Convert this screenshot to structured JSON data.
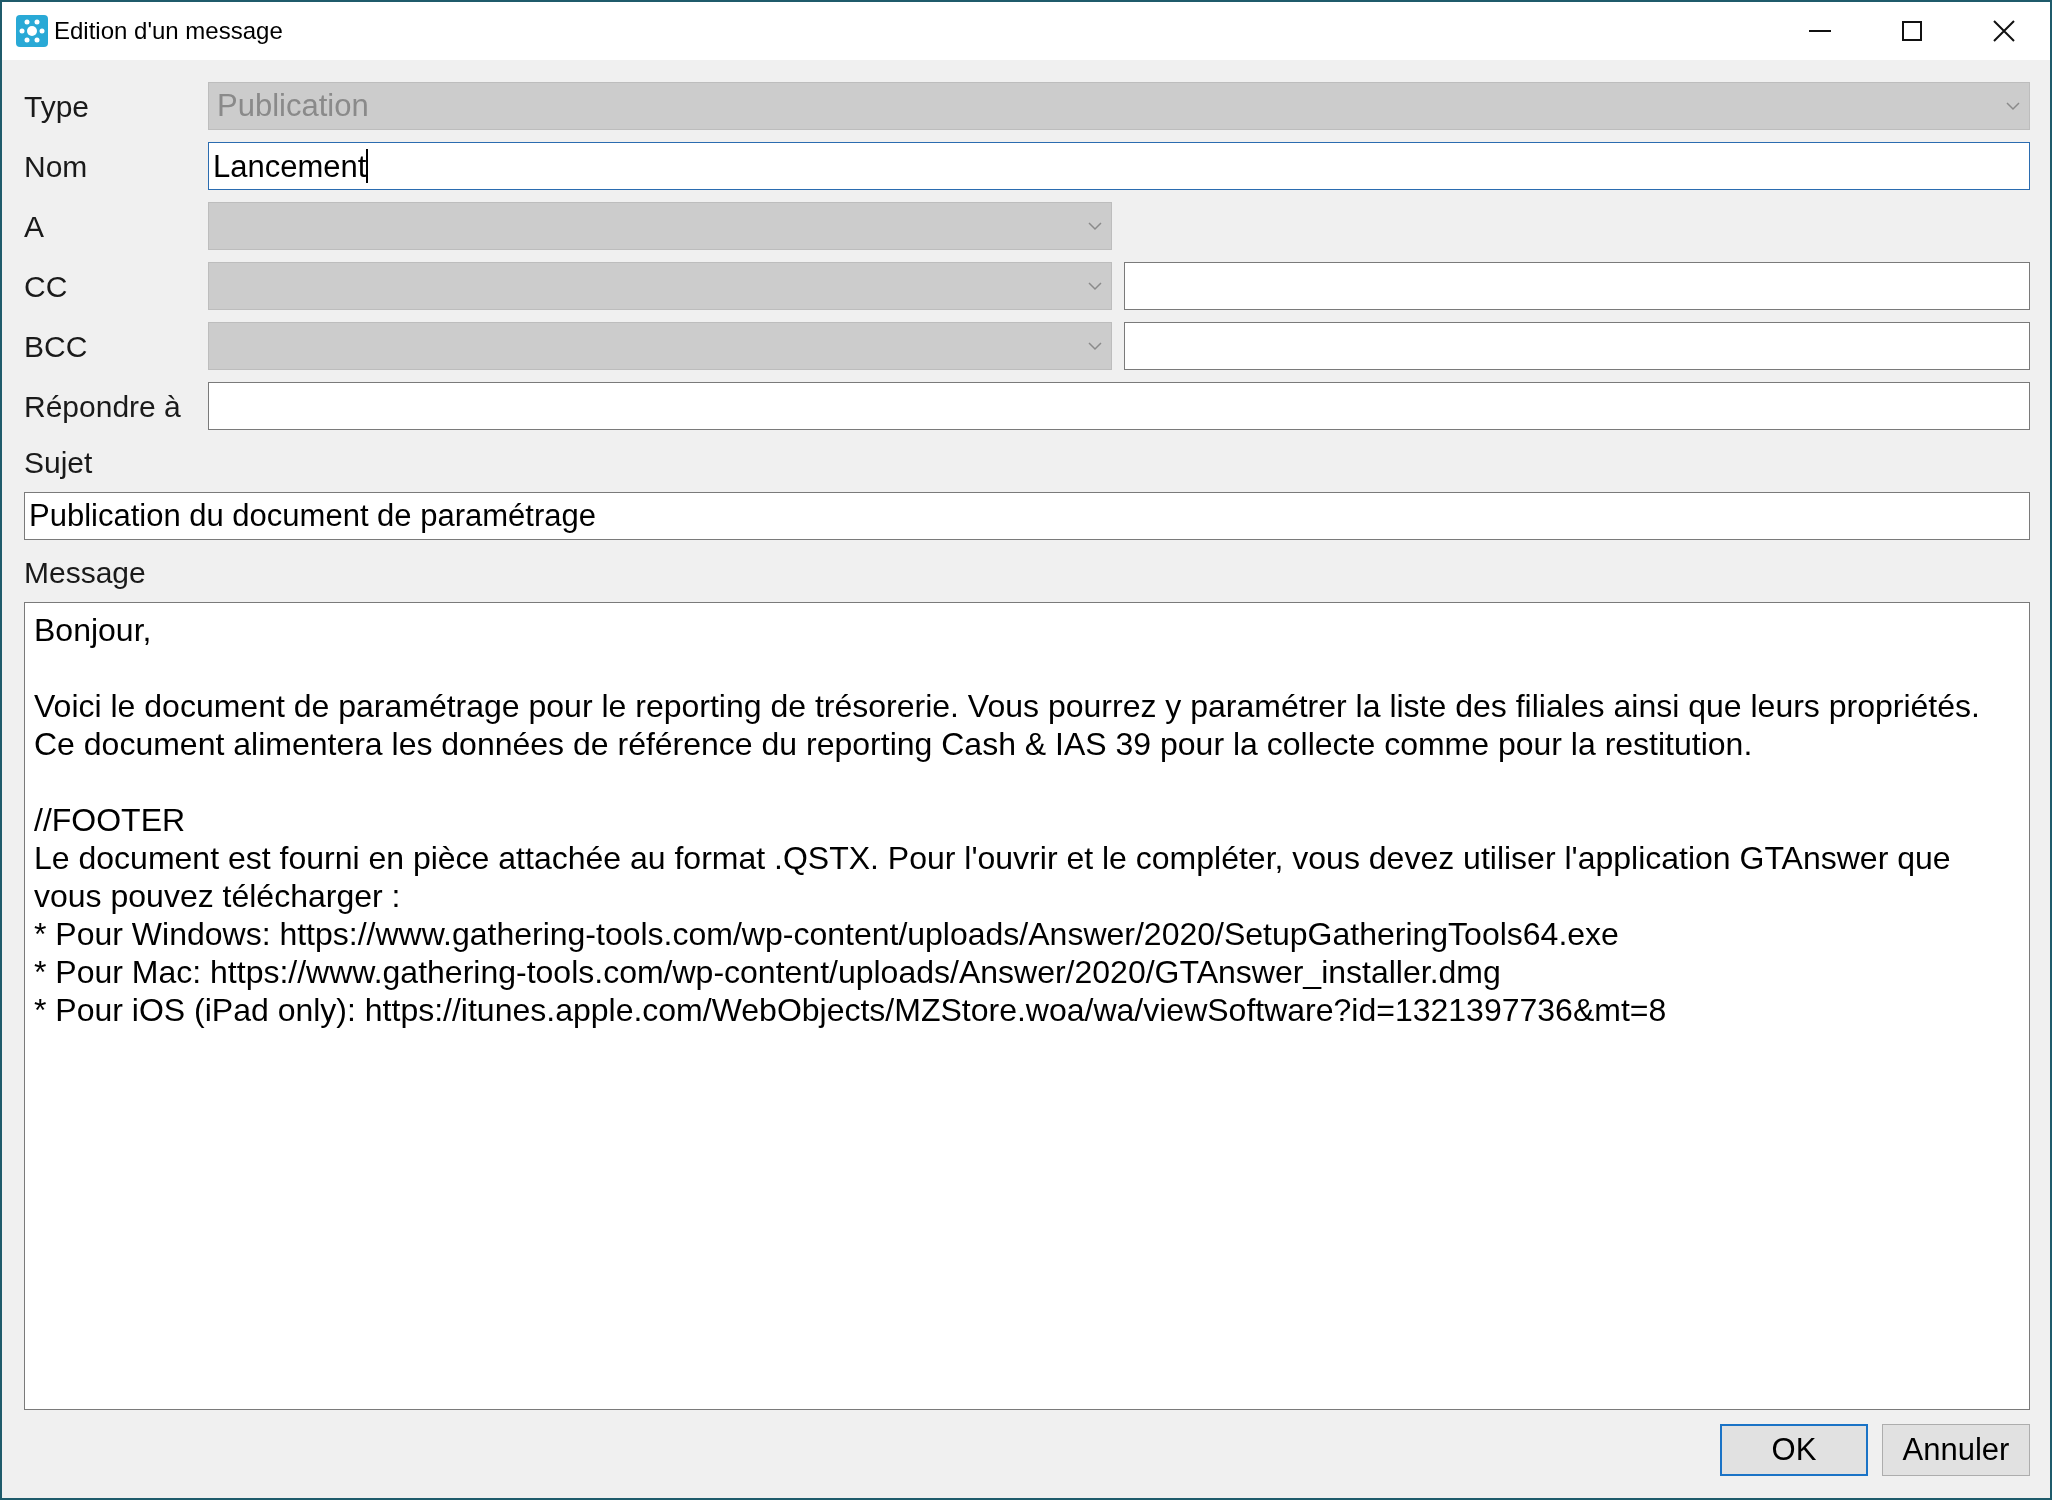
{
  "window": {
    "title": "Edition d'un message"
  },
  "rows": [
    {
      "label": "Type",
      "kind": "dropdown",
      "value": "Publication",
      "disabled": true
    },
    {
      "label": "Nom",
      "kind": "text",
      "value": "Lancement",
      "focused": true
    },
    {
      "label": "A",
      "kind": "dropdown_half",
      "disabled": true
    },
    {
      "label": "CC",
      "kind": "dropdown_with_text",
      "disabled": true
    },
    {
      "label": "BCC",
      "kind": "dropdown_with_text",
      "disabled": true
    },
    {
      "label": "Répondre à",
      "kind": "text",
      "focused": false
    }
  ],
  "subject": {
    "label": "Sujet",
    "value": "Publication du document de paramétrage"
  },
  "message": {
    "label": "Message",
    "paragraphs": [
      [
        "Bonjour,"
      ],
      [
        "Voici le document de paramétrage pour le reporting de trésorerie. Vous pourrez y paramétrer la liste des filiales ainsi que leurs propriétés. Ce document alimentera les données de référence du reporting Cash & IAS 39 pour la collecte comme pour la restitution."
      ],
      [
        "//FOOTER",
        "Le document est fourni en pièce attachée au format .QSTX. Pour l'ouvrir et le compléter, vous devez utiliser l'application GTAnswer que vous pouvez télécharger :",
        "* Pour Windows: https://www.gathering-tools.com/wp-content/uploads/Answer/2020/SetupGatheringTools64.exe",
        "* Pour Mac: https://www.gathering-tools.com/wp-content/uploads/Answer/2020/GTAnswer_installer.dmg",
        "* Pour iOS (iPad only): https://itunes.apple.com/WebObjects/MZStore.woa/wa/viewSoftware?id=1321397736&mt=8"
      ]
    ]
  },
  "buttons": [
    {
      "label": "OK",
      "default": true
    },
    {
      "label": "Annuler",
      "default": false
    }
  ]
}
